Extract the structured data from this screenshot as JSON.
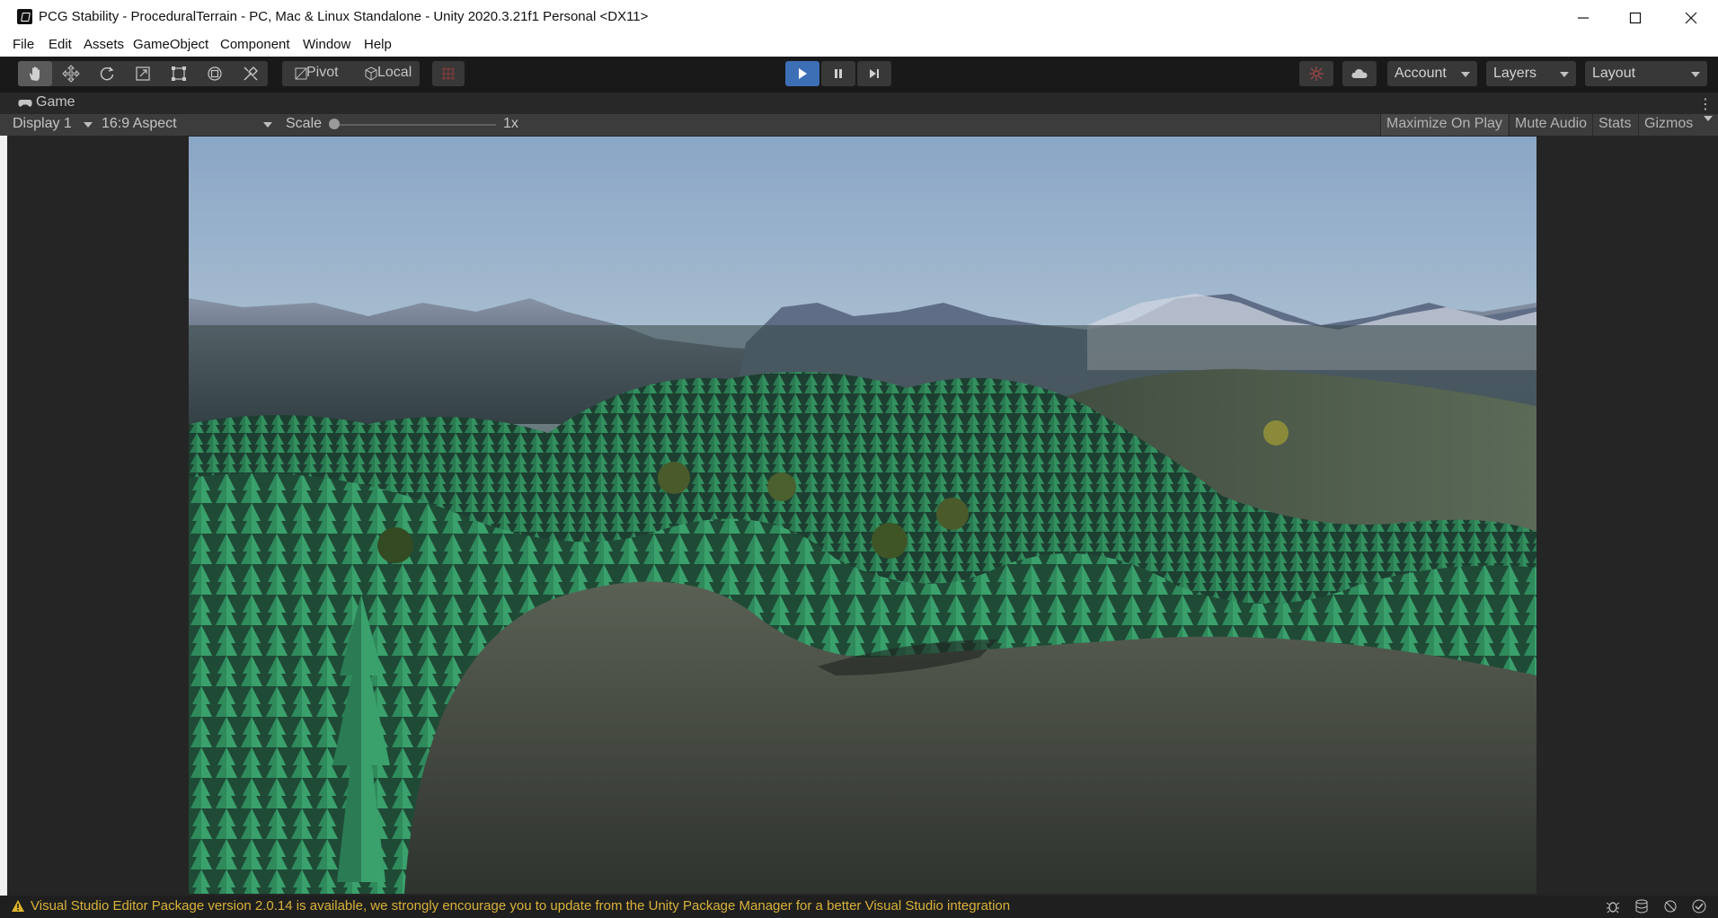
{
  "window": {
    "title": "PCG Stability - ProceduralTerrain - PC, Mac & Linux Standalone - Unity 2020.3.21f1 Personal <DX11>",
    "icons": [
      "unity-logo-icon",
      "minimize-icon",
      "maximize-icon",
      "close-icon"
    ]
  },
  "menu": {
    "items": [
      "File",
      "Edit",
      "Assets",
      "GameObject",
      "Component",
      "Window",
      "Help"
    ]
  },
  "toolbar": {
    "tools": [
      "hand-tool-icon",
      "move-tool-icon",
      "rotate-tool-icon",
      "scale-tool-icon",
      "rect-tool-icon",
      "transform-tool-icon",
      "custom-tool-icon"
    ],
    "pivot_label": "Pivot",
    "local_label": "Local",
    "play_controls": [
      "play-icon",
      "pause-icon",
      "step-icon"
    ],
    "account_label": "Account",
    "layers_label": "Layers",
    "layout_label": "Layout",
    "accent_color": "#3d6fb6"
  },
  "game_tab": {
    "label": "Game"
  },
  "game_toolbar": {
    "display_label": "Display 1",
    "aspect_label": "16:9 Aspect",
    "scale_label": "Scale",
    "scale_value": "1x",
    "maximize_label": "Maximize On Play",
    "mute_label": "Mute Audio",
    "stats_label": "Stats",
    "gizmos_label": "Gizmos"
  },
  "status": {
    "message": "Visual Studio Editor Package version 2.0.14 is available, we strongly encourage you to update from the Unity Package Manager for a better Visual Studio integration",
    "warning_color": "#d8b23a"
  }
}
